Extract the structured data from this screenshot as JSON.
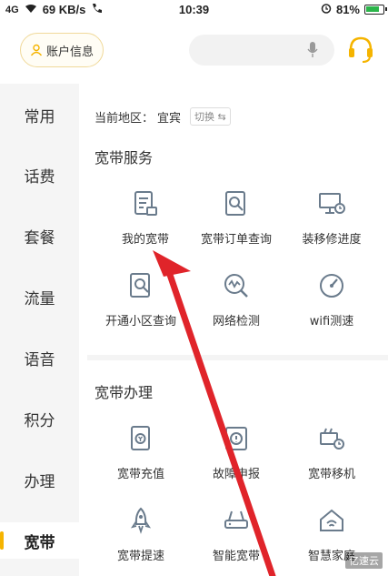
{
  "status_bar": {
    "signal": "4G",
    "speed": "69 KB/s",
    "time": "10:39",
    "battery": "81%"
  },
  "header": {
    "account_label": "账户信息",
    "search_placeholder": ""
  },
  "sidebar": {
    "items": [
      {
        "label": "常用",
        "active": false
      },
      {
        "label": "话费",
        "active": false
      },
      {
        "label": "套餐",
        "active": false
      },
      {
        "label": "流量",
        "active": false
      },
      {
        "label": "语音",
        "active": false
      },
      {
        "label": "积分",
        "active": false
      },
      {
        "label": "办理",
        "active": false
      },
      {
        "label": "宽带",
        "active": true
      }
    ]
  },
  "region": {
    "prefix": "当前地区：",
    "name": "宜宾",
    "switch_label": "切换"
  },
  "sections": [
    {
      "title": "宽带服务",
      "items": [
        {
          "label": "我的宽带",
          "icon": "document-broadband-icon"
        },
        {
          "label": "宽带订单查询",
          "icon": "order-search-icon"
        },
        {
          "label": "装移修进度",
          "icon": "monitor-clock-icon"
        },
        {
          "label": "开通小区查询",
          "icon": "community-search-icon"
        },
        {
          "label": "网络检测",
          "icon": "network-test-icon"
        },
        {
          "label": "wifi测速",
          "icon": "speed-gauge-icon"
        }
      ]
    },
    {
      "title": "宽带办理",
      "items": [
        {
          "label": "宽带充值",
          "icon": "recharge-icon"
        },
        {
          "label": "故障申报",
          "icon": "fault-report-icon"
        },
        {
          "label": "宽带移机",
          "icon": "relocate-icon"
        },
        {
          "label": "宽带提速",
          "icon": "rocket-icon"
        },
        {
          "label": "智能宽带",
          "icon": "router-icon"
        },
        {
          "label": "智慧家庭",
          "icon": "smart-home-icon"
        }
      ]
    }
  ],
  "colors": {
    "accent": "#f5b400",
    "icon": "#6a7b8c",
    "arrow": "#e0242a"
  },
  "watermark": "亿速云"
}
